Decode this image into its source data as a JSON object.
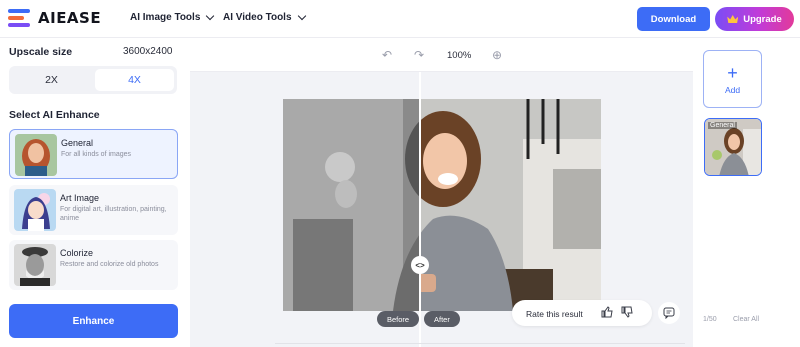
{
  "brand": {
    "name": "AIEASE"
  },
  "nav": [
    {
      "label": "AI Image Tools"
    },
    {
      "label": "AI Video Tools"
    }
  ],
  "header": {
    "download_label": "Download",
    "upgrade_label": "Upgrade"
  },
  "upscale": {
    "title": "Upscale size",
    "size": "3600x2400",
    "options": [
      "2X",
      "4X"
    ],
    "selected": "4X"
  },
  "enhance": {
    "title": "Select AI Enhance",
    "cards": [
      {
        "title": "General",
        "desc": "For all kinds of images",
        "selected": true
      },
      {
        "title": "Art Image",
        "desc": "For digital art, illustration, painting, anime",
        "selected": false
      },
      {
        "title": "Colorize",
        "desc": "Restore and colorize old photos",
        "selected": false
      }
    ],
    "button_label": "Enhance"
  },
  "toolbar": {
    "zoom": "100%",
    "icons": [
      "undo-icon",
      "redo-icon",
      "locate-icon"
    ]
  },
  "compare": {
    "before_label": "Before",
    "after_label": "After",
    "handle_glyph": "<>"
  },
  "rating": {
    "label": "Rate this result"
  },
  "history": {
    "add_label": "Add",
    "add_glyph": "+",
    "thumb_label": "General",
    "count": "1/50",
    "clear_label": "Clear All"
  },
  "colors": {
    "accent": "#3d6cf6",
    "upgrade_start": "#7a4df5",
    "upgrade_end": "#e23a9a",
    "canvas_bg": "#f2f3f7"
  }
}
